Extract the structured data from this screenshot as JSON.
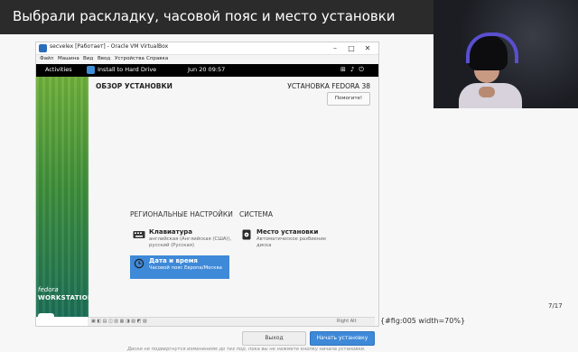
{
  "slide": {
    "title": "Выбрали раскладку, часовой пояс и место установки",
    "page_counter": "7/17",
    "caption_fragment": "{#fig:005 width=70%}"
  },
  "vm": {
    "title": "secvelex [Работает] - Oracle VM VirtualBox",
    "menu": [
      "Файл",
      "Машина",
      "Вид",
      "Ввод",
      "Устройства",
      "Справка"
    ],
    "status_right": "Right Alt"
  },
  "gnome": {
    "activities": "Activities",
    "app": "Install to Hard Drive",
    "clock": "Jun 20  09:57"
  },
  "installer": {
    "hub_title": "ОБЗОР УСТАНОВКИ",
    "product": "УСТАНОВКА FEDORA 38",
    "help_label": "Помогите!",
    "categories": {
      "regional": "РЕГИОНАЛЬНЫЕ НАСТРОЙКИ",
      "system": "СИСТЕМА"
    },
    "spokes": {
      "keyboard": {
        "title": "Клавиатура",
        "status": "английская (Английская (США)), русский (Русская)"
      },
      "datetime": {
        "title": "Дата и время",
        "status": "Часовой пояс Европа/Москва"
      },
      "destination": {
        "title": "Место установки",
        "status": "Автоматическое разбиение диска"
      }
    },
    "quit_label": "Выход",
    "begin_label": "Начать установку",
    "warning": "Диски не подвергнутся изменениям до тех пор, пока вы не нажмете кнопку начала установки."
  },
  "sidebar": {
    "brand_line1": "fedora",
    "brand_line2": "WORKSTATION"
  },
  "colors": {
    "accent": "#3e89d8",
    "gnome_bar": "#000000",
    "slide_title_bar": "#2b2b2b"
  },
  "icons": [
    "keyboard-icon",
    "clock-icon",
    "disk-icon",
    "minimize-icon",
    "maximize-icon",
    "close-icon"
  ]
}
